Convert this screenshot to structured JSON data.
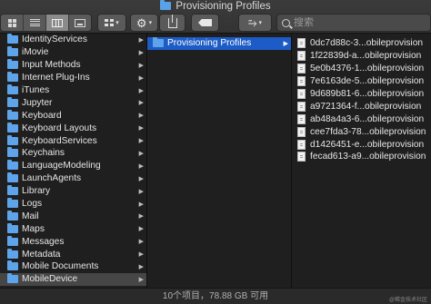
{
  "window": {
    "title": "Provisioning Profiles",
    "title_icon": "folder-icon"
  },
  "toolbar": {
    "view_modes": [
      "icon",
      "list",
      "column",
      "cover-flow"
    ],
    "active_view": "column",
    "group_icon": "grid-icon",
    "action_icon": "gear-icon",
    "share_icon": "share-icon",
    "tag_icon": "tag-icon",
    "path_icon": "path-icon",
    "search_placeholder": "搜索"
  },
  "columns": {
    "col1": [
      {
        "label": "IdentityServices",
        "has_children": true
      },
      {
        "label": "iMovie",
        "has_children": true
      },
      {
        "label": "Input Methods",
        "has_children": true
      },
      {
        "label": "Internet Plug-Ins",
        "has_children": true
      },
      {
        "label": "iTunes",
        "has_children": true
      },
      {
        "label": "Jupyter",
        "has_children": true
      },
      {
        "label": "Keyboard",
        "has_children": true
      },
      {
        "label": "Keyboard Layouts",
        "has_children": true
      },
      {
        "label": "KeyboardServices",
        "has_children": true
      },
      {
        "label": "Keychains",
        "has_children": true
      },
      {
        "label": "LanguageModeling",
        "has_children": true
      },
      {
        "label": "LaunchAgents",
        "has_children": true
      },
      {
        "label": "Library",
        "has_children": true
      },
      {
        "label": "Logs",
        "has_children": true
      },
      {
        "label": "Mail",
        "has_children": true
      },
      {
        "label": "Maps",
        "has_children": true
      },
      {
        "label": "Messages",
        "has_children": true
      },
      {
        "label": "Metadata",
        "has_children": true
      },
      {
        "label": "Mobile Documents",
        "has_children": true
      },
      {
        "label": "MobileDevice",
        "has_children": true,
        "selected": true
      }
    ],
    "col2": [
      {
        "label": "Provisioning Profiles",
        "has_children": true,
        "selected": true
      }
    ],
    "col3": [
      "0dc7d88c-3...obileprovision",
      "1f22839d-a...obileprovision",
      "5e0b4376-1...obileprovision",
      "7e6163de-5...obileprovision",
      "9d689b81-6...obileprovision",
      "a9721364-f...obileprovision",
      "ab48a4a3-6...obileprovision",
      "cee7fda3-78...obileprovision",
      "d1426451-e...obileprovision",
      "fecad613-a9...obileprovision"
    ]
  },
  "statusbar": {
    "text": "10个项目，78.88 GB 可用",
    "watermark": "@稀金技术社区"
  },
  "colors": {
    "selection": "#1d5cc6",
    "folder": "#5ea4ea",
    "background": "#1f1f1f"
  }
}
